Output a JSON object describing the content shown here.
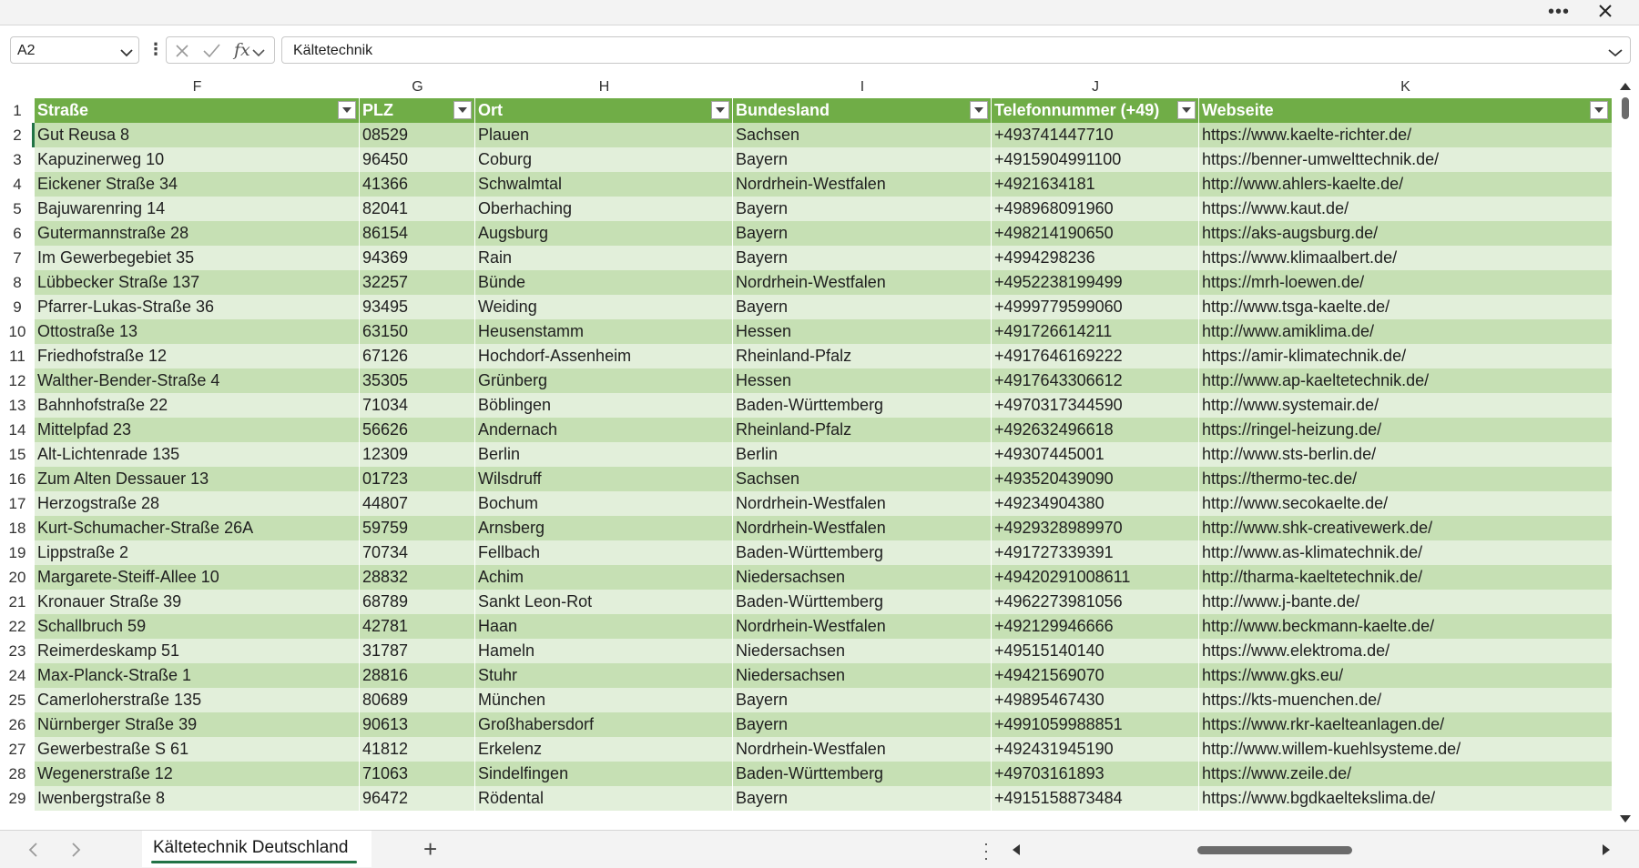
{
  "window": {
    "more_label": "•••"
  },
  "formula_bar": {
    "name_box": "A2",
    "fx_label": "fx",
    "content": "Kältetechnik"
  },
  "columns": [
    {
      "letter": "F",
      "header": "Straße"
    },
    {
      "letter": "G",
      "header": "PLZ"
    },
    {
      "letter": "H",
      "header": "Ort"
    },
    {
      "letter": "I",
      "header": "Bundesland"
    },
    {
      "letter": "J",
      "header": "Telefonnummer (+49)"
    },
    {
      "letter": "K",
      "header": "Webseite"
    }
  ],
  "header_row_number": "1",
  "rows": [
    {
      "n": "2",
      "cells": [
        "Gut Reusa 8",
        "08529",
        "Plauen",
        "Sachsen",
        "+493741447710",
        "https://www.kaelte-richter.de/"
      ]
    },
    {
      "n": "3",
      "cells": [
        "Kapuzinerweg 10",
        "96450",
        "Coburg",
        "Bayern",
        "+4915904991100",
        "https://benner-umwelttechnik.de/"
      ]
    },
    {
      "n": "4",
      "cells": [
        "Eickener Straße 34",
        "41366",
        "Schwalmtal",
        "Nordrhein-Westfalen",
        "+4921634181",
        "http://www.ahlers-kaelte.de/"
      ]
    },
    {
      "n": "5",
      "cells": [
        "Bajuwarenring 14",
        "82041",
        "Oberhaching",
        "Bayern",
        "+498968091960",
        "https://www.kaut.de/"
      ]
    },
    {
      "n": "6",
      "cells": [
        "Gutermannstraße 28",
        "86154",
        "Augsburg",
        "Bayern",
        "+498214190650",
        "https://aks-augsburg.de/"
      ]
    },
    {
      "n": "7",
      "cells": [
        "Im Gewerbegebiet 35",
        "94369",
        "Rain",
        "Bayern",
        "+4994298236",
        "https://www.klimaalbert.de/"
      ]
    },
    {
      "n": "8",
      "cells": [
        "Lübbecker Straße 137",
        "32257",
        "Bünde",
        "Nordrhein-Westfalen",
        "+4952238199499",
        "https://mrh-loewen.de/"
      ]
    },
    {
      "n": "9",
      "cells": [
        "Pfarrer-Lukas-Straße 36",
        "93495",
        "Weiding",
        "Bayern",
        "+4999779599060",
        "http://www.tsga-kaelte.de/"
      ]
    },
    {
      "n": "10",
      "cells": [
        "Ottostraße 13",
        "63150",
        "Heusenstamm",
        "Hessen",
        "+491726614211",
        "http://www.amiklima.de/"
      ]
    },
    {
      "n": "11",
      "cells": [
        "Friedhofstraße 12",
        "67126",
        "Hochdorf-Assenheim",
        "Rheinland-Pfalz",
        "+4917646169222",
        "https://amir-klimatechnik.de/"
      ]
    },
    {
      "n": "12",
      "cells": [
        "Walther-Bender-Straße 4",
        "35305",
        "Grünberg",
        "Hessen",
        "+4917643306612",
        "http://www.ap-kaeltetechnik.de/"
      ]
    },
    {
      "n": "13",
      "cells": [
        "Bahnhofstraße 22",
        "71034",
        "Böblingen",
        "Baden-Württemberg",
        "+4970317344590",
        "http://www.systemair.de/"
      ]
    },
    {
      "n": "14",
      "cells": [
        "Mittelpfad 23",
        "56626",
        "Andernach",
        "Rheinland-Pfalz",
        "+492632496618",
        "https://ringel-heizung.de/"
      ]
    },
    {
      "n": "15",
      "cells": [
        "Alt-Lichtenrade 135",
        "12309",
        "Berlin",
        "Berlin",
        "+49307445001",
        "http://www.sts-berlin.de/"
      ]
    },
    {
      "n": "16",
      "cells": [
        "Zum Alten Dessauer 13",
        "01723",
        "Wilsdruff",
        "Sachsen",
        "+493520439090",
        "https://thermo-tec.de/"
      ]
    },
    {
      "n": "17",
      "cells": [
        "Herzogstraße 28",
        "44807",
        "Bochum",
        "Nordrhein-Westfalen",
        "+49234904380",
        "http://www.secokaelte.de/"
      ]
    },
    {
      "n": "18",
      "cells": [
        "Kurt-Schumacher-Straße 26A",
        "59759",
        "Arnsberg",
        "Nordrhein-Westfalen",
        "+4929328989970",
        "http://www.shk-creativewerk.de/"
      ]
    },
    {
      "n": "19",
      "cells": [
        "Lippstraße 2",
        "70734",
        "Fellbach",
        "Baden-Württemberg",
        "+491727339391",
        "http://www.as-klimatechnik.de/"
      ]
    },
    {
      "n": "20",
      "cells": [
        "Margarete-Steiff-Allee 10",
        "28832",
        "Achim",
        "Niedersachsen",
        "+49420291008611",
        "http://tharma-kaeltetechnik.de/"
      ]
    },
    {
      "n": "21",
      "cells": [
        "Kronauer Straße 39",
        "68789",
        "Sankt Leon-Rot",
        "Baden-Württemberg",
        "+4962273981056",
        "http://www.j-bante.de/"
      ]
    },
    {
      "n": "22",
      "cells": [
        "Schallbruch 59",
        "42781",
        "Haan",
        "Nordrhein-Westfalen",
        "+492129946666",
        "http://www.beckmann-kaelte.de/"
      ]
    },
    {
      "n": "23",
      "cells": [
        "Reimerdeskamp 51",
        "31787",
        "Hameln",
        "Niedersachsen",
        "+49515140140",
        "https://www.elektroma.de/"
      ]
    },
    {
      "n": "24",
      "cells": [
        "Max-Planck-Straße 1",
        "28816",
        "Stuhr",
        "Niedersachsen",
        "+49421569070",
        "https://www.gks.eu/"
      ]
    },
    {
      "n": "25",
      "cells": [
        "Camerloherstraße 135",
        "80689",
        "München",
        "Bayern",
        "+49895467430",
        "https://kts-muenchen.de/"
      ]
    },
    {
      "n": "26",
      "cells": [
        "Nürnberger Straße 39",
        "90613",
        "Großhabersdorf",
        "Bayern",
        "+4991059988851",
        "https://www.rkr-kaelteanlagen.de/"
      ]
    },
    {
      "n": "27",
      "cells": [
        "Gewerbestraße S 61",
        "41812",
        "Erkelenz",
        "Nordrhein-Westfalen",
        "+492431945190",
        "http://www.willem-kuehlsysteme.de/"
      ]
    },
    {
      "n": "28",
      "cells": [
        "Wegenerstraße 12",
        "71063",
        "Sindelfingen",
        "Baden-Württemberg",
        "+49703161893",
        "https://www.zeile.de/"
      ]
    },
    {
      "n": "29",
      "cells": [
        "Iwenbergstraße 8",
        "96472",
        "Rödental",
        "Bayern",
        "+4915158873484",
        "https://www.bgdkaeltekslima.de/"
      ]
    }
  ],
  "sheet_tabs": {
    "active": "Kältetechnik Deutschland",
    "add_label": "+"
  },
  "colors": {
    "header_green": "#70ad47",
    "band_dark": "#c6e0b4",
    "band_light": "#e2efda",
    "accent": "#217346"
  }
}
